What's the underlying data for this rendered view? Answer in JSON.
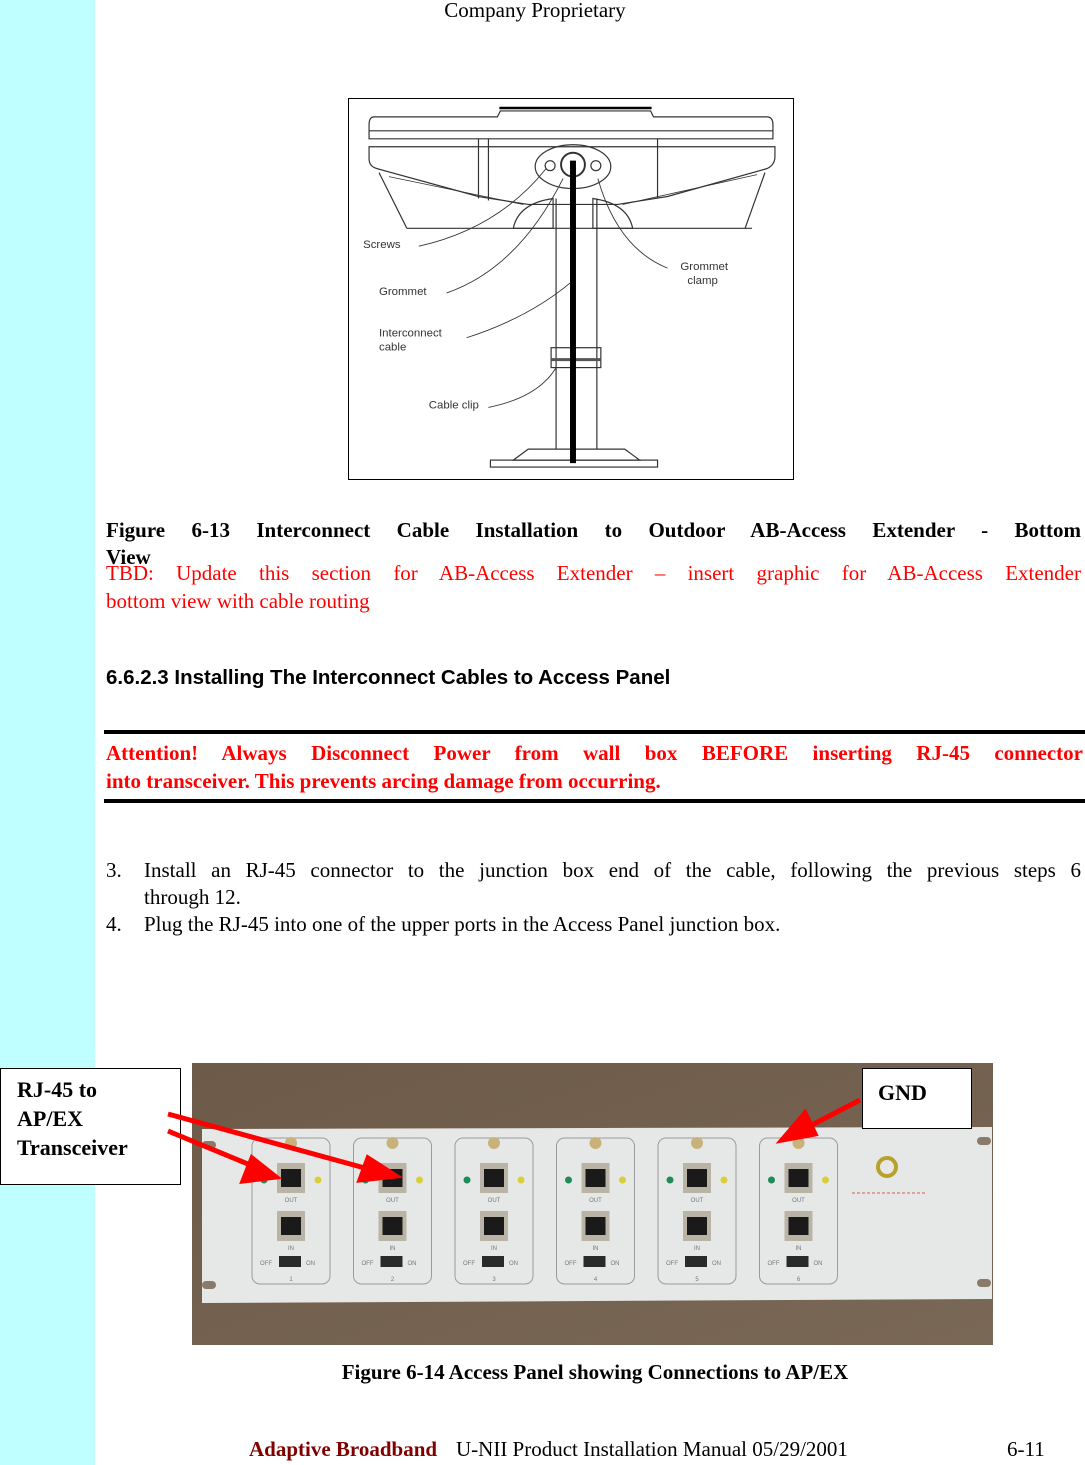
{
  "header": {
    "text": "Company Proprietary"
  },
  "figure_6_13": {
    "callouts": {
      "screws": "Screws",
      "grommet": "Grommet",
      "interconnect_cable_line1": "Interconnect",
      "interconnect_cable_line2": "cable",
      "cable_clip": "Cable clip",
      "grommet_clamp_line1": "Grommet",
      "grommet_clamp_line2": "clamp"
    },
    "caption_line1": "Figure 6-13   Interconnect Cable Installation to Outdoor AB-Access Extender - Bottom",
    "caption_line2": "View"
  },
  "tbd_note": {
    "line1": "TBD: Update this section for AB-Access Extender – insert graphic for AB-Access Extender",
    "line2": "bottom view with cable routing"
  },
  "section": {
    "heading": "6.6.2.3  Installing The Interconnect Cables to Access Panel"
  },
  "attention": {
    "line1": "Attention!  Always Disconnect Power from wall box BEFORE inserting RJ-45 connector",
    "line2": "into transceiver.  This prevents arcing damage from occurring."
  },
  "steps": [
    {
      "num": "3.",
      "line1": "Install an RJ-45 connector to the junction box end of the cable, following the previous steps 6",
      "line2": "through 12."
    },
    {
      "num": "4.",
      "line1": "Plug the RJ-45 into one of the upper ports in the Access Panel junction box.",
      "line2": ""
    }
  ],
  "figure_6_14": {
    "callout_rj45": {
      "line1": "RJ-45 to",
      "line2": "AP/EX",
      "line3": "Transceiver"
    },
    "callout_gnd": "GND",
    "port_labels": {
      "out": "OUT",
      "in": "IN",
      "off": "OFF",
      "on": "ON"
    },
    "modules": [
      "1",
      "2",
      "3",
      "4",
      "5",
      "6"
    ],
    "caption": "Figure 6-14  Access Panel  showing Connections to AP/EX",
    "colors": {
      "arrow": "#ff0000",
      "led_green": "#1f8a5a",
      "led_yellow": "#d8cf3a"
    }
  },
  "footer": {
    "brand": "Adaptive Broadband",
    "title": "U-NII Product Installation Manual  05/29/2001",
    "page": "6-11"
  }
}
